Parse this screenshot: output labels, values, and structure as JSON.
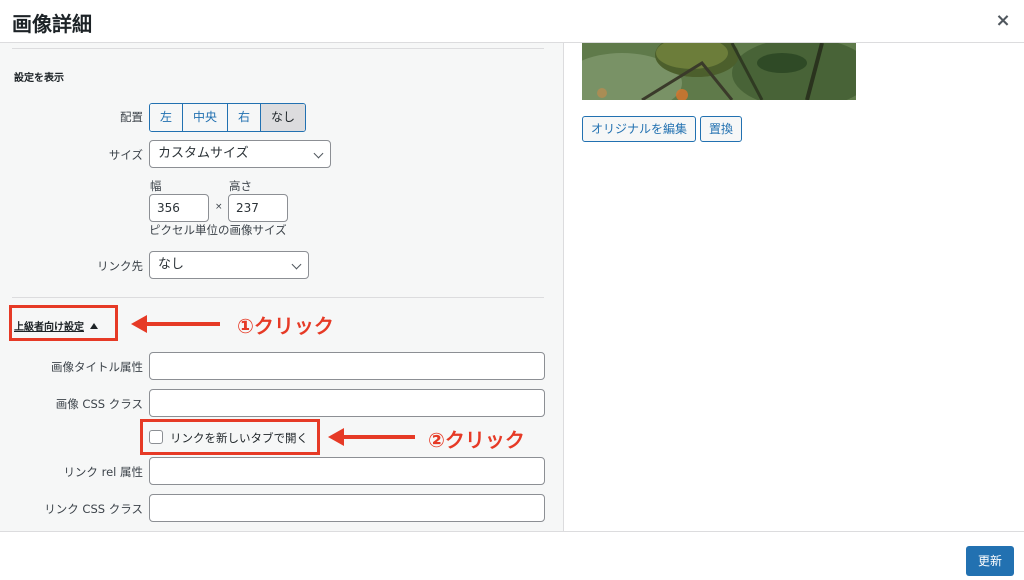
{
  "header": {
    "title": "画像詳細",
    "close_icon": "×"
  },
  "settings": {
    "section_title": "設定を表示",
    "align": {
      "label": "配置",
      "options": [
        "左",
        "中央",
        "右",
        "なし"
      ],
      "selected": "なし"
    },
    "size": {
      "label": "サイズ",
      "value": "カスタムサイズ"
    },
    "width": {
      "label": "幅",
      "value": "356"
    },
    "times": "×",
    "height": {
      "label": "高さ",
      "value": "237"
    },
    "size_note": "ピクセル単位の画像サイズ",
    "link": {
      "label": "リンク先",
      "value": "なし"
    }
  },
  "advanced": {
    "toggle_label": "上級者向け設定",
    "title_attr": {
      "label": "画像タイトル属性",
      "value": ""
    },
    "css_class": {
      "label": "画像 CSS クラス",
      "value": ""
    },
    "new_tab": {
      "label": "リンクを新しいタブで開く",
      "checked": false
    },
    "link_rel": {
      "label": "リンク rel 属性",
      "value": ""
    },
    "link_css": {
      "label": "リンク CSS クラス",
      "value": ""
    }
  },
  "annotations": {
    "step1": "①クリック",
    "step2": "②クリック",
    "color": "#e63a26"
  },
  "image_panel": {
    "edit_original": "オリジナルを編集",
    "replace": "置換"
  },
  "footer": {
    "update": "更新"
  },
  "colors": {
    "primary": "#2271b1",
    "annotation": "#e63a26"
  }
}
